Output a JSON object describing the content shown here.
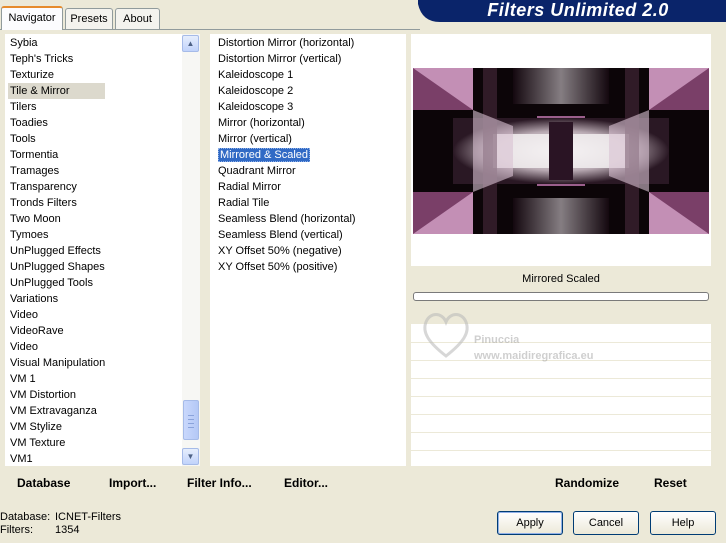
{
  "tabs": [
    {
      "label": "Navigator",
      "active": true
    },
    {
      "label": "Presets",
      "active": false
    },
    {
      "label": "About",
      "active": false
    }
  ],
  "app_title": "Filters Unlimited 2.0",
  "categories": {
    "items": [
      "Sybia",
      "Teph's Tricks",
      "Texturize",
      "Tile & Mirror",
      "Tilers",
      "Toadies",
      "Tools",
      "Tormentia",
      "Tramages",
      "Transparency",
      "Tronds Filters",
      "Two Moon",
      "Tymoes",
      "UnPlugged Effects",
      "UnPlugged Shapes",
      "UnPlugged Tools",
      "Variations",
      "Video",
      "VideoRave",
      "Video",
      "Visual Manipulation",
      "VM 1",
      "VM Distortion",
      "VM Extravaganza",
      "VM Stylize",
      "VM Texture",
      "VM1"
    ],
    "selected": "Tile & Mirror"
  },
  "filters": {
    "items": [
      "Distortion Mirror (horizontal)",
      "Distortion Mirror (vertical)",
      "Kaleidoscope 1",
      "Kaleidoscope 2",
      "Kaleidoscope 3",
      "Mirror (horizontal)",
      "Mirror (vertical)",
      "Mirrored & Scaled",
      "Quadrant Mirror",
      "Radial Mirror",
      "Radial Tile",
      "Seamless Blend (horizontal)",
      "Seamless Blend (vertical)",
      "XY Offset 50% (negative)",
      "XY Offset 50% (positive)"
    ],
    "selected": "Mirrored & Scaled"
  },
  "preview": {
    "filter_name": "Mirrored  Scaled",
    "watermark_name": "Pinuccia",
    "watermark_url": "www.maidiregrafica.eu"
  },
  "toolbar": {
    "database": "Database",
    "import": "Import...",
    "filter_info": "Filter Info...",
    "editor": "Editor...",
    "randomize": "Randomize",
    "reset": "Reset"
  },
  "status": {
    "database_label": "Database:",
    "database_value": "ICNET-Filters",
    "filters_label": "Filters:",
    "filters_value": "1354"
  },
  "buttons": {
    "apply": "Apply",
    "cancel": "Cancel",
    "help": "Help"
  },
  "colors": {
    "banner": "#0a246a",
    "selection": "#316ac5",
    "preview_pink": "#c890b8"
  }
}
